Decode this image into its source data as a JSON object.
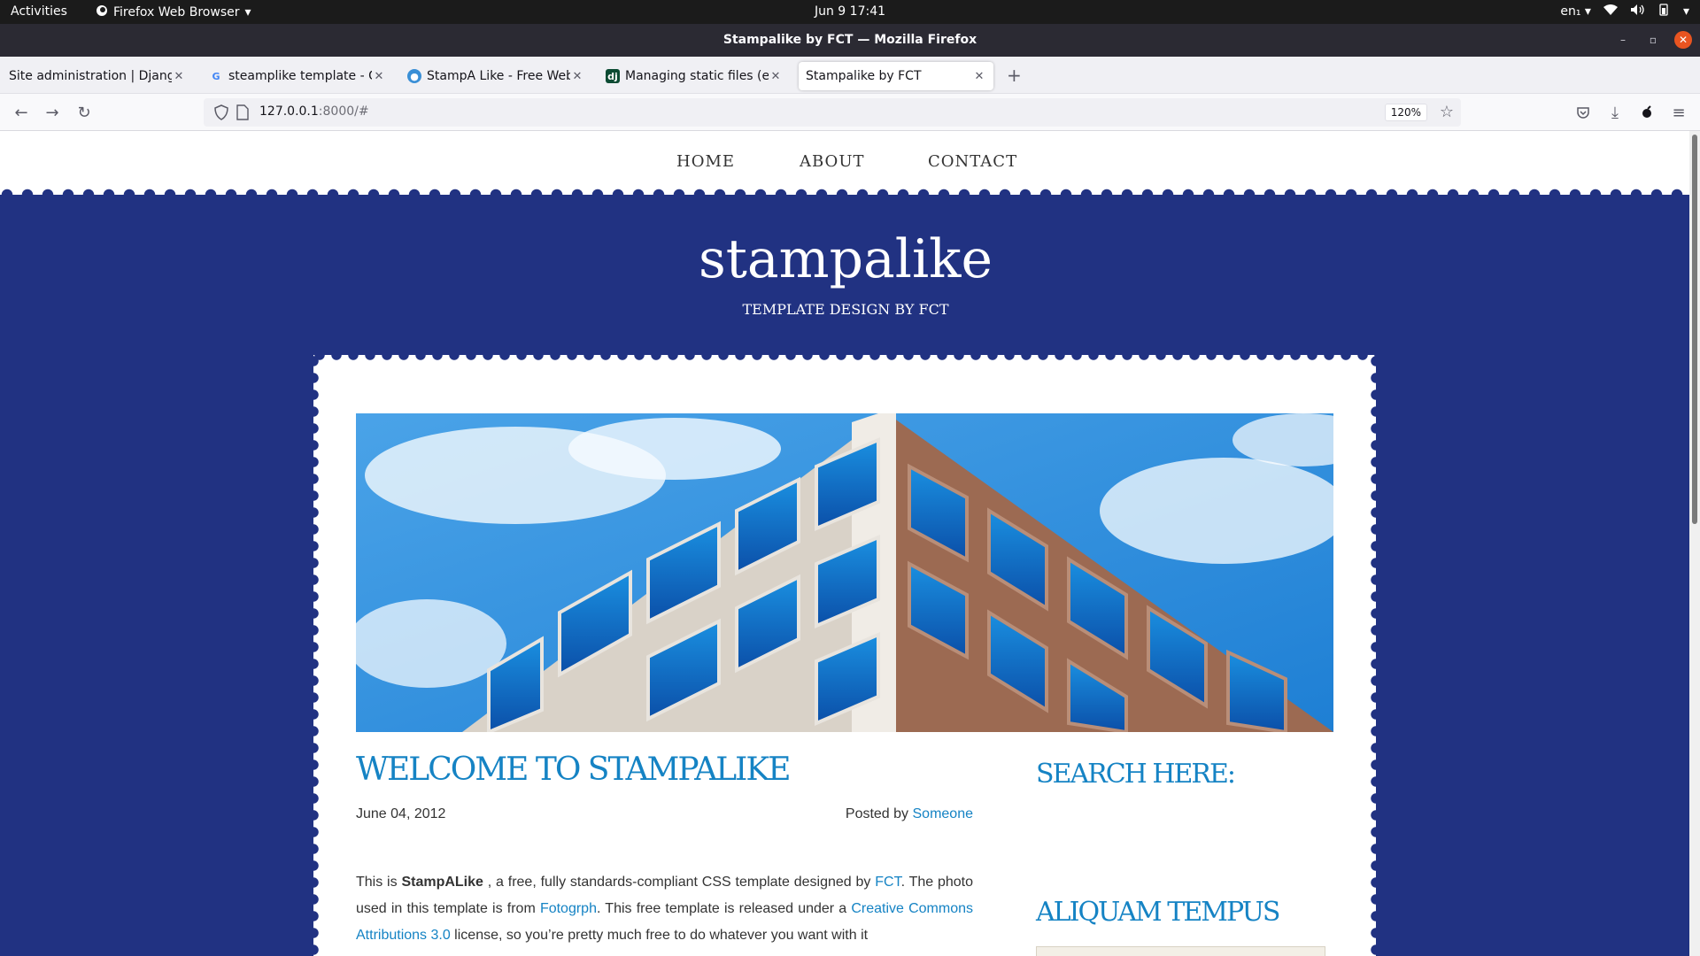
{
  "os": {
    "activities": "Activities",
    "app_name": "Firefox Web Browser",
    "clock": "Jun 9  17:41",
    "lang": "en₁"
  },
  "window": {
    "title": "Stampalike by FCT — Mozilla Firefox"
  },
  "tabs": [
    {
      "label": "Site administration | Django",
      "icon": "django-icon"
    },
    {
      "label": "steamplike template - Go",
      "icon": "google-icon"
    },
    {
      "label": "StampA Like - Free Websi",
      "icon": "stampa-icon"
    },
    {
      "label": "Managing static files (e.g",
      "icon": "django-docs-icon"
    },
    {
      "label": "Stampalike by FCT",
      "icon": "",
      "active": true
    }
  ],
  "urlbar": {
    "host": "127.0.0.1",
    "rest": ":8000/#",
    "zoom": "120%"
  },
  "site": {
    "nav": [
      "HOME",
      "ABOUT",
      "CONTACT"
    ],
    "brand": "stampalike",
    "tagline": "TEMPLATE DESIGN BY FCT",
    "post": {
      "title": "WELCOME TO STAMPALIKE",
      "date": "June 04, 2012",
      "posted_by_prefix": "Posted by ",
      "author": "Someone",
      "body": {
        "t1": "This is ",
        "b1": "StampALike",
        "t2": " , a free, fully standards-compliant CSS template designed by ",
        "l1": "FCT",
        "t3": ". The photo used in this template is from ",
        "l2": "Fotogrph",
        "t4": ". This free template is released under a ",
        "l3": "Creative Commons Attributions 3.0",
        "t5": " license, so you’re pretty much free to do whatever you want with it"
      }
    },
    "sidebar": {
      "search_heading": "SEARCH HERE:",
      "search_value": "",
      "section2_heading": "ALIQUAM TEMPUS"
    }
  },
  "colors": {
    "site_blue": "#213282",
    "accent": "#1583c4"
  }
}
